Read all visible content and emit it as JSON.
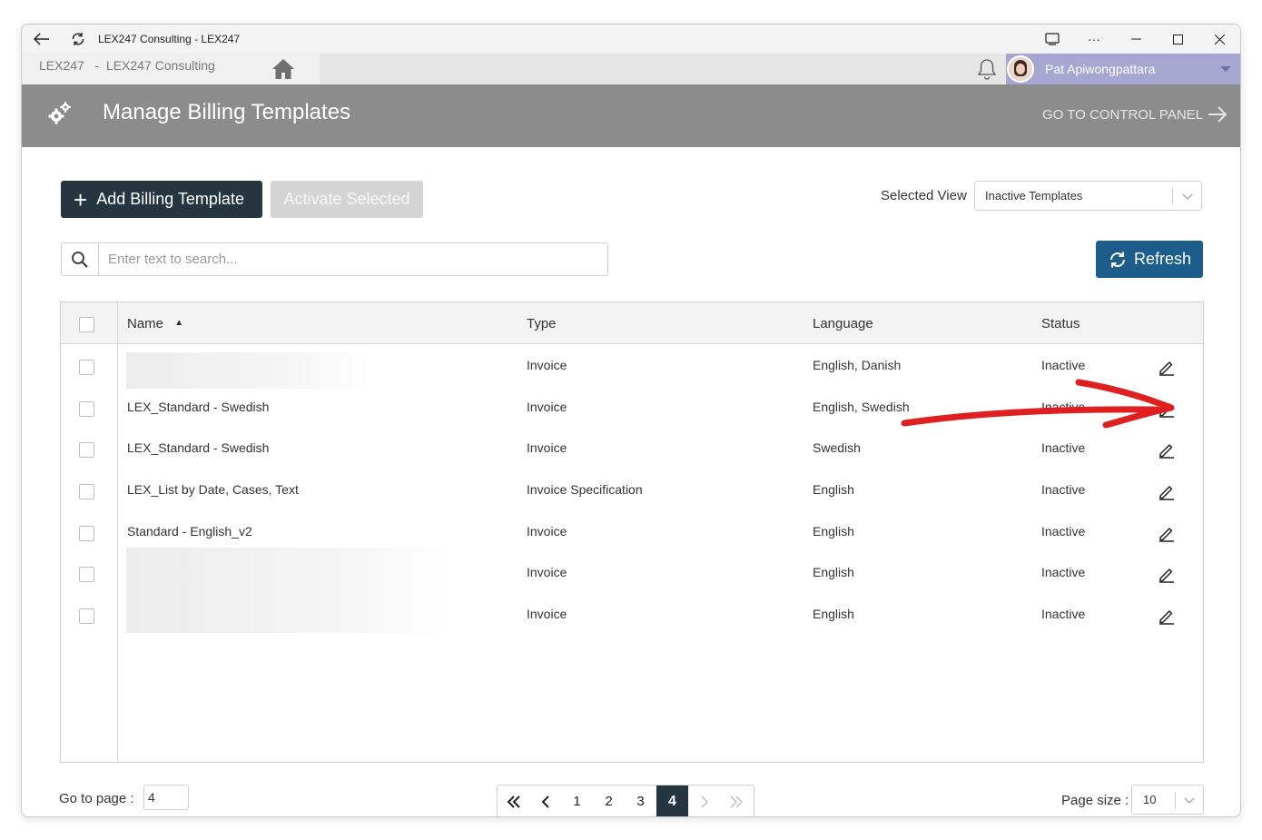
{
  "window": {
    "title": "LEX247 Consulting - LEX247",
    "back_icon": "arrow-left-icon",
    "reload_icon": "refresh-icon"
  },
  "nav": {
    "breadcrumb": "LEX247   -  LEX247 Consulting",
    "user_name": "Pat Apiwongpattara"
  },
  "header": {
    "title": "Manage Billing Templates",
    "control_panel_link": "GO TO CONTROL PANEL"
  },
  "toolbar": {
    "add_label": "Add Billing Template",
    "activate_label": "Activate Selected",
    "selected_view_label": "Selected View",
    "selected_view_value": "Inactive Templates",
    "search_placeholder": "Enter text to search...",
    "refresh_label": "Refresh"
  },
  "grid": {
    "columns": [
      "Name",
      "Type",
      "Language",
      "Status"
    ],
    "sort_indicator": "▲",
    "rows": [
      {
        "name": "",
        "type": "Invoice",
        "language": "English, Danish",
        "status": "Inactive"
      },
      {
        "name": "LEX_Standard - Swedish",
        "type": "Invoice",
        "language": "English, Swedish",
        "status": "Inactive"
      },
      {
        "name": "LEX_Standard - Swedish",
        "type": "Invoice",
        "language": "Swedish",
        "status": "Inactive"
      },
      {
        "name": "LEX_List by Date, Cases, Text",
        "type": "Invoice Specification",
        "language": "English",
        "status": "Inactive"
      },
      {
        "name": "Standard - English_v2",
        "type": "Invoice",
        "language": "English",
        "status": "Inactive"
      },
      {
        "name": "",
        "type": "Invoice",
        "language": "English",
        "status": "Inactive"
      },
      {
        "name": "",
        "type": "Invoice",
        "language": "English",
        "status": "Inactive"
      }
    ]
  },
  "pager": {
    "goto_label": "Go to page :",
    "goto_value": "4",
    "pages": [
      "1",
      "2",
      "3",
      "4"
    ],
    "current_page": "4",
    "page_size_label": "Page size :",
    "page_size_value": "10"
  },
  "colors": {
    "header_bg": "#8c8c8c",
    "primary_dark": "#253640",
    "refresh_blue": "#1c5d8c",
    "user_bar": "#a6a6d1",
    "annotation_red": "#e02020"
  }
}
